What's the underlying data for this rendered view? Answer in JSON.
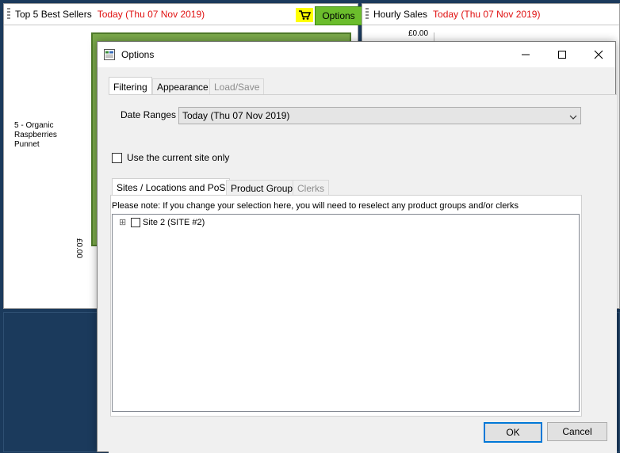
{
  "dashboard": {
    "best_sellers_panel": {
      "title": "Top 5 Best Sellers",
      "date": "Today (Thu 07 Nov 2019)",
      "options_label": "Options",
      "bar_label": "5 - Organic Raspberries Punnet",
      "axis_label": "£0.00"
    },
    "hourly_panel": {
      "title": "Hourly Sales",
      "date": "Today (Thu 07 Nov 2019)",
      "axis_label": "£0.00"
    }
  },
  "dialog": {
    "title": "Options",
    "tabs": [
      {
        "label": "Filtering",
        "active": true
      },
      {
        "label": "Appearance",
        "active": false
      },
      {
        "label": "Load/Save",
        "active": false,
        "disabled": true
      }
    ],
    "date_ranges_label": "Date Ranges",
    "date_ranges_value": "Today (Thu 07 Nov 2019)",
    "current_site_label": "Use the current site only",
    "sub_tabs": [
      {
        "label": "Sites / Locations and PoS",
        "active": true
      },
      {
        "label": "Product Group",
        "active": false
      },
      {
        "label": "Clerks",
        "active": false,
        "disabled": true
      }
    ],
    "note": "Please note: If you change your selection here, you will need to reselect any product groups and/or clerks",
    "tree_items": [
      {
        "label": "Site 2 (SITE #2)",
        "checked": false,
        "expand_glyph": "⊞"
      }
    ],
    "ok_label": "OK",
    "cancel_label": "Cancel"
  },
  "icons": {
    "cart": "shopping-cart-icon",
    "expand": "plus-box-icon"
  },
  "colors": {
    "date_red": "#e01010",
    "options_green": "#6bbd2c",
    "bar_green": "#7aa84a",
    "ok_border": "#0078d7"
  }
}
